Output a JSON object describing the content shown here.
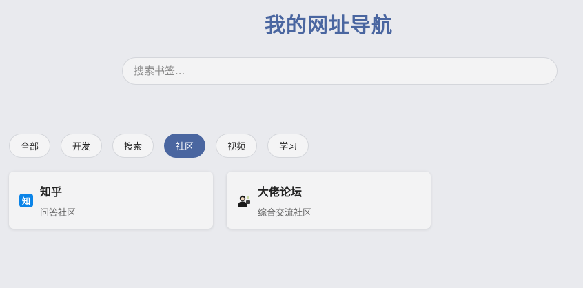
{
  "header": {
    "title": "我的网址导航"
  },
  "search": {
    "placeholder": "搜索书签...",
    "value": ""
  },
  "tabs": [
    {
      "label": "全部",
      "active": false
    },
    {
      "label": "开发",
      "active": false
    },
    {
      "label": "搜索",
      "active": false
    },
    {
      "label": "社区",
      "active": true
    },
    {
      "label": "视频",
      "active": false
    },
    {
      "label": "学习",
      "active": false
    }
  ],
  "cards": [
    {
      "icon_text": "知",
      "icon": "zhihu-logo-icon",
      "title": "知乎",
      "description": "问答社区"
    },
    {
      "icon": "avatar-icon",
      "title": "大佬论坛",
      "description": "综合交流社区"
    }
  ],
  "colors": {
    "accent": "#4a66a0",
    "background": "#e9eaee",
    "zhihu_blue": "#0b84e8"
  }
}
